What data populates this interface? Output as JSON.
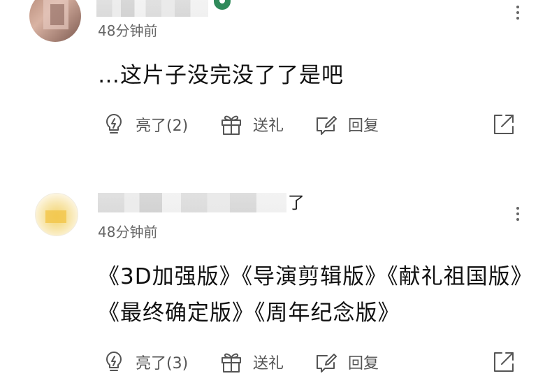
{
  "comments": [
    {
      "time": "48分钟前",
      "name_tail": "",
      "text": "…这片子没完没了了是吧",
      "actions": {
        "like_label": "亮了(2)",
        "gift_label": "送礼",
        "reply_label": "回复"
      }
    },
    {
      "time": "48分钟前",
      "name_tail": "了",
      "text": "《3D加强版》《导演剪辑版》《献礼祖国版》《最终确定版》《周年纪念版》",
      "actions": {
        "like_label": "亮了(3)",
        "gift_label": "送礼",
        "reply_label": "回复"
      }
    }
  ],
  "icons": {
    "like": "lightbulb-icon",
    "gift": "gift-icon",
    "reply": "edit-reply-icon",
    "share": "share-icon",
    "more": "more-vertical-icon"
  },
  "colors": {
    "text": "#111111",
    "muted": "#666666",
    "icon": "#555555",
    "badge": "#2f8a5a"
  }
}
